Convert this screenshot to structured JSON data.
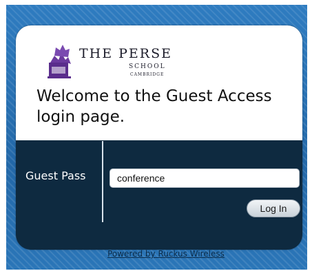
{
  "logo": {
    "line1": "THE PERSE",
    "line2": "SCHOOL",
    "line3": "CAMBRIDGE",
    "crest_icon": "school-crest-icon"
  },
  "welcome": {
    "text": "Welcome to the Guest Access login page."
  },
  "form": {
    "label": "Guest Pass",
    "value": "conference",
    "button_label": "Log In"
  },
  "footer": {
    "link_text": "Powered by Ruckus Wireless"
  },
  "colors": {
    "background": "#2a73b4",
    "panel": "#0e2a40",
    "card": "#ffffff",
    "crest": "#5a2d8c"
  }
}
